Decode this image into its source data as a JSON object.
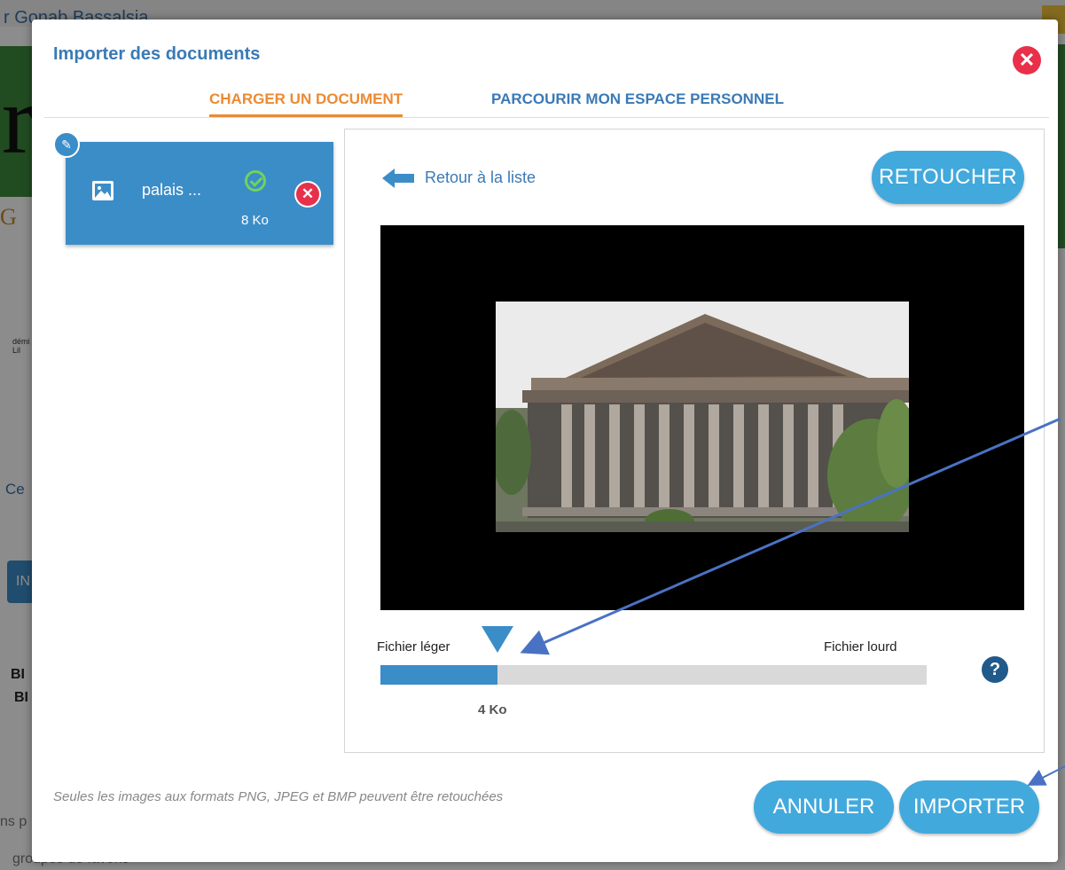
{
  "background_page": {
    "top_text": "r Gonab Bassalsia",
    "big_letter": "r",
    "orange_text": "G",
    "small_logo_text": "démi Lil",
    "ce_text": "Ce",
    "blue_button_text": "IN",
    "bold_line_1": "BI",
    "bold_line_2": "BI",
    "ns_text": "ns p",
    "groupes_text": "groupes de favoris"
  },
  "modal": {
    "title": "Importer des documents",
    "close_icon": "close-icon",
    "tabs": [
      {
        "label": "CHARGER UN DOCUMENT",
        "active": true
      },
      {
        "label": "PARCOURIR MON ESPACE PERSONNEL",
        "active": false
      }
    ],
    "file": {
      "name": "palais ...",
      "size": "8 Ko",
      "status": "uploaded",
      "icon": "image-icon"
    },
    "preview": {
      "back_label": "Retour à la liste",
      "retouch_label": "RETOUCHER",
      "slider": {
        "min_label": "Fichier léger",
        "max_label": "Fichier lourd",
        "value_label": "4 Ko",
        "fraction": 0.215
      },
      "help_icon": "question-icon"
    },
    "footer": {
      "note": "Seules les images aux formats PNG, JPEG et BMP peuvent être retouchées",
      "cancel_label": "ANNULER",
      "import_label": "IMPORTER"
    }
  },
  "colors": {
    "accent_blue": "#3b8dc8",
    "button_blue": "#42a9dc",
    "title_blue": "#3a7ab6",
    "active_tab_orange": "#ec8a32",
    "danger_red": "#e8304a",
    "success_green": "#6fd35c"
  }
}
